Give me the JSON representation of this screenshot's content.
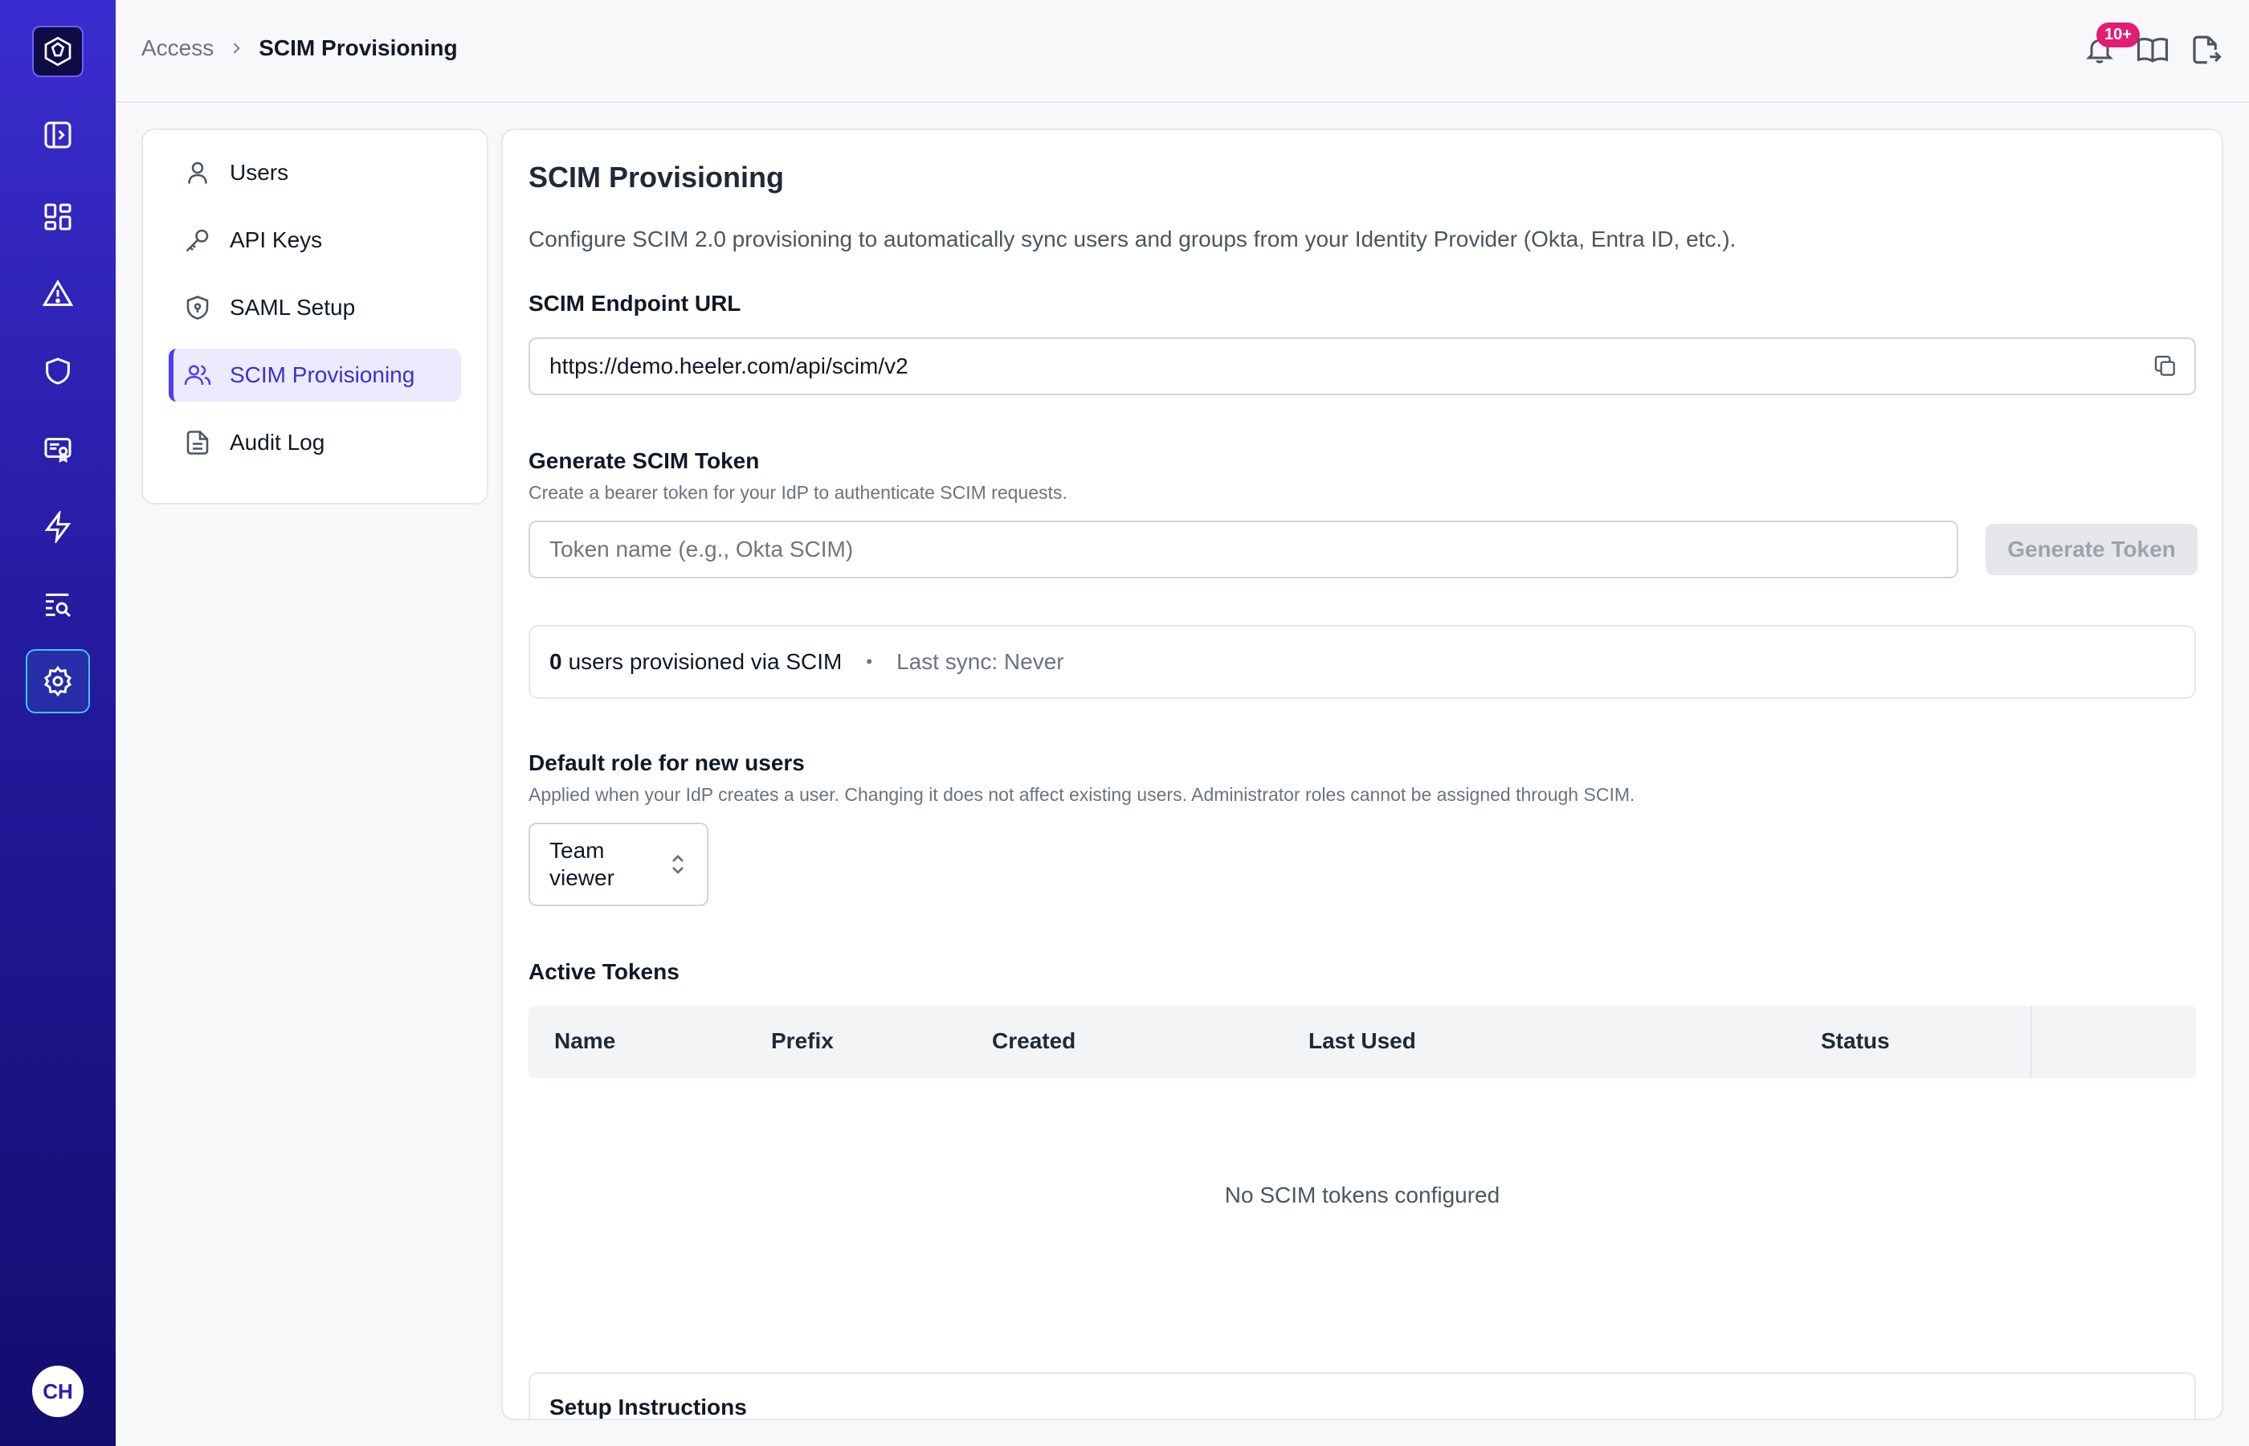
{
  "user": {
    "initials": "CH"
  },
  "breadcrumb": {
    "parent": "Access",
    "current": "SCIM Provisioning"
  },
  "header": {
    "notification_count": "10+"
  },
  "subnav": {
    "items": [
      {
        "label": "Users",
        "icon": "user-icon"
      },
      {
        "label": "API Keys",
        "icon": "key-icon"
      },
      {
        "label": "SAML Setup",
        "icon": "shield-check-icon"
      },
      {
        "label": "SCIM Provisioning",
        "icon": "users-icon",
        "active": true
      },
      {
        "label": "Audit Log",
        "icon": "document-icon"
      }
    ]
  },
  "main": {
    "title": "SCIM Provisioning",
    "description": "Configure SCIM 2.0 provisioning to automatically sync users and groups from your Identity Provider (Okta, Entra ID, etc.).",
    "endpoint": {
      "label": "SCIM Endpoint URL",
      "value": "https://demo.heeler.com/api/scim/v2"
    },
    "generate": {
      "label": "Generate SCIM Token",
      "help": "Create a bearer token for your IdP to authenticate SCIM requests.",
      "placeholder": "Token name (e.g., Okta SCIM)",
      "button": "Generate Token"
    },
    "stats": {
      "count": "0",
      "count_text": "users provisioned via SCIM",
      "bullet": "•",
      "last_sync": "Last sync: Never"
    },
    "default_role": {
      "label": "Default role for new users",
      "help": "Applied when your IdP creates a user. Changing it does not affect existing users. Administrator roles cannot be assigned through SCIM.",
      "value_line1": "Team",
      "value_line2": "viewer"
    },
    "tokens": {
      "label": "Active Tokens",
      "columns": [
        "Name",
        "Prefix",
        "Created",
        "Last Used",
        "Status"
      ],
      "empty": "No SCIM tokens configured"
    },
    "setup": {
      "label": "Setup Instructions"
    }
  },
  "colors": {
    "accent": "#4f3ff0",
    "rail_top": "#3a2dcf",
    "rail_bottom": "#120d6e",
    "badge": "#e11d74"
  }
}
